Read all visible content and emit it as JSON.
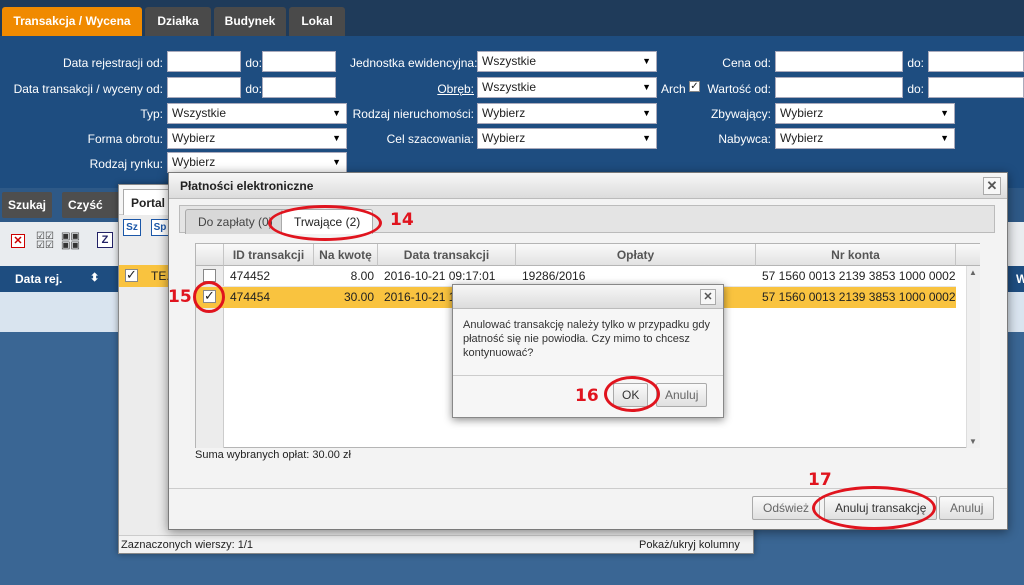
{
  "tabs": [
    "Transakcja / Wycena",
    "Działka",
    "Budynek",
    "Lokal"
  ],
  "filters": {
    "data_rejestracji_od": "Data rejestracji od:",
    "data_transakcji_od": "Data transakcji / wyceny od:",
    "do": "do:",
    "typ": "Typ:",
    "typ_value": "Wszystkie",
    "forma_obrotu": "Forma obrotu:",
    "forma_obrotu_value": "Wybierz",
    "rodzaj_rynku": "Rodzaj rynku:",
    "rodzaj_rynku_value": "Wybierz",
    "jednostka": "Jednostka ewidencyjna:",
    "jednostka_value": "Wszystkie",
    "obreb": "Obręb:",
    "obreb_value": "Wszystkie",
    "arch": "Arch",
    "arch_checked": "✓",
    "rodzaj_nieruchomosci": "Rodzaj nieruchomości:",
    "rodzaj_nieruchomosci_value": "Wybierz",
    "cel_szacowania": "Cel szacowania:",
    "cel_szacowania_value": "Wybierz",
    "cena_od": "Cena od:",
    "wartosc_od": "Wartość od:",
    "zbywajacy": "Zbywający:",
    "zbywajacy_value": "Wybierz",
    "nabywca": "Nabywca:",
    "nabywca_value": "Wybierz"
  },
  "actions": {
    "szukaj": "Szukaj",
    "czysc": "Czyść kr"
  },
  "grid": {
    "col_data_rej": "Data rej.",
    "sort_icon": "sort-arrows-icon",
    "row_text": "TE.",
    "row_check": "✓",
    "last_col": "W"
  },
  "portal": {
    "tab": "Portal",
    "status": "Zaznaczonych wierszy: 1/1",
    "columns_toggle": "Pokaż/ukryj kolumny",
    "btn_sz": "Sz",
    "btn_sp": "Sp"
  },
  "dialog": {
    "title": "Płatności elektroniczne",
    "tab_do_zaplaty": "Do zapłaty (0)",
    "tab_trwajace": "Trwające (2)",
    "headers": [
      "ID transakcji",
      "Na kwotę",
      "Data transakcji",
      "Opłaty",
      "Nr konta"
    ],
    "rows": [
      {
        "id": "474452",
        "amount": "8.00",
        "date": "2016-10-21 09:17:01",
        "fee": "19286/2016",
        "account": "57 1560 0013 2139 3853 1000 0002",
        "checked": ""
      },
      {
        "id": "474454",
        "amount": "30.00",
        "date": "2016-10-21 1",
        "fee": "",
        "account": "57 1560 0013 2139 3853 1000 0002",
        "checked": "✓"
      }
    ],
    "sum": "Suma wybranych opłat: 30.00 zł",
    "btn_refresh": "Odśwież",
    "btn_cancel_tx": "Anuluj transakcję",
    "btn_cancel": "Anuluj"
  },
  "confirm": {
    "message": "Anulować transakcję należy tylko w przypadku gdy płatność się nie powiodła. Czy mimo to chcesz kontynuować?",
    "ok": "OK",
    "cancel": "Anuluj"
  },
  "annotations": {
    "n14": "14",
    "n15": "15",
    "n16": "16",
    "n17": "17"
  },
  "colors": {
    "accent": "#f08a00",
    "header": "#1e4d80",
    "selected_row": "#f9c33f",
    "annotation": "#e0141e"
  }
}
